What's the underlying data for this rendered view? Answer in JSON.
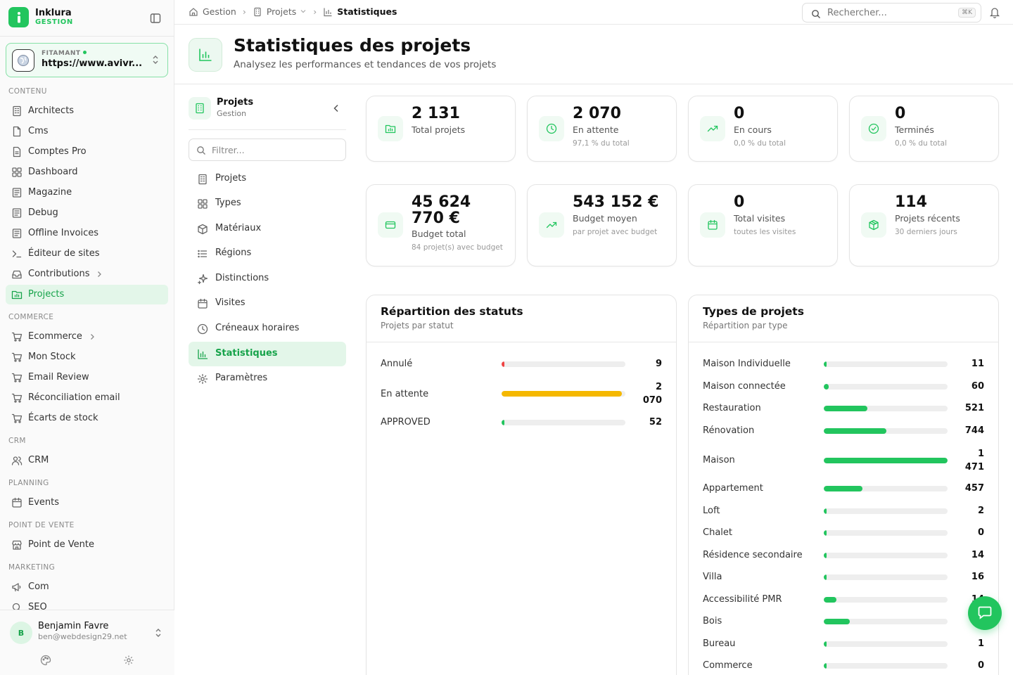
{
  "brand": {
    "name": "Inklura",
    "sub": "GESTION"
  },
  "site": {
    "label": "FITAMANT",
    "url": "https://www.avivr..."
  },
  "sidebar": {
    "sections": [
      {
        "title": "CONTENU",
        "items": [
          {
            "label": "Architects",
            "icon": "building-icon"
          },
          {
            "label": "Cms",
            "icon": "file-icon"
          },
          {
            "label": "Comptes Pro",
            "icon": "file-text-icon"
          },
          {
            "label": "Dashboard",
            "icon": "grid-icon"
          },
          {
            "label": "Magazine",
            "icon": "newspaper-icon"
          },
          {
            "label": "Debug",
            "icon": "newspaper-icon"
          },
          {
            "label": "Offline Invoices",
            "icon": "newspaper-icon"
          },
          {
            "label": "Éditeur de sites",
            "icon": "terminal-icon"
          },
          {
            "label": "Contributions",
            "icon": "inbox-icon",
            "has_children": true
          },
          {
            "label": "Projects",
            "icon": "folder-chart-icon",
            "active": true
          }
        ]
      },
      {
        "title": "COMMERCE",
        "items": [
          {
            "label": "Ecommerce",
            "icon": "cart-icon",
            "has_children": true
          },
          {
            "label": "Mon Stock",
            "icon": "cart-icon"
          },
          {
            "label": "Email Review",
            "icon": "cart-icon"
          },
          {
            "label": "Réconciliation email",
            "icon": "cart-icon"
          },
          {
            "label": "Écarts de stock",
            "icon": "cart-icon"
          }
        ]
      },
      {
        "title": "CRM",
        "items": [
          {
            "label": "CRM",
            "icon": "users-icon"
          }
        ]
      },
      {
        "title": "PLANNING",
        "items": [
          {
            "label": "Events",
            "icon": "calendar-icon"
          }
        ]
      },
      {
        "title": "POINT DE VENTE",
        "items": [
          {
            "label": "Point de Vente",
            "icon": "store-icon"
          }
        ]
      },
      {
        "title": "MARKETING",
        "items": [
          {
            "label": "Com",
            "icon": "megaphone-icon"
          },
          {
            "label": "SEO",
            "icon": "search-icon"
          }
        ]
      }
    ]
  },
  "user": {
    "initial": "B",
    "name": "Benjamin Favre",
    "email": "ben@webdesign29.net"
  },
  "breadcrumb": {
    "home": "Gestion",
    "section": "Projets",
    "current": "Statistiques"
  },
  "search": {
    "placeholder": "Rechercher...",
    "shortcut": "⌘K"
  },
  "page": {
    "title": "Statistiques des projets",
    "subtitle": "Analysez les performances et tendances de vos projets"
  },
  "inner_nav": {
    "title": "Projets",
    "subtitle": "Gestion",
    "filter_placeholder": "Filtrer...",
    "items": [
      {
        "label": "Projets",
        "icon": "building-icon"
      },
      {
        "label": "Types",
        "icon": "grid-icon"
      },
      {
        "label": "Matériaux",
        "icon": "box-icon"
      },
      {
        "label": "Régions",
        "icon": "list-icon"
      },
      {
        "label": "Distinctions",
        "icon": "sparkle-icon"
      },
      {
        "label": "Visites",
        "icon": "calendar-icon"
      },
      {
        "label": "Créneaux horaires",
        "icon": "clock-icon"
      },
      {
        "label": "Statistiques",
        "icon": "bar-chart-icon",
        "active": true
      },
      {
        "label": "Paramètres",
        "icon": "gear-icon"
      }
    ]
  },
  "stats": [
    {
      "value": "2 131",
      "label": "Total projets",
      "sub": "",
      "icon": "folder-chart-icon"
    },
    {
      "value": "2 070",
      "label": "En attente",
      "sub": "97,1 % du total",
      "icon": "clock-icon"
    },
    {
      "value": "0",
      "label": "En cours",
      "sub": "0,0 % du total",
      "icon": "trending-up-icon"
    },
    {
      "value": "0",
      "label": "Terminés",
      "sub": "0,0 % du total",
      "icon": "check-circle-icon"
    },
    {
      "value_line1": "45 624",
      "value_line2": "770 €",
      "label": "Budget total",
      "sub": "84 projet(s) avec budget",
      "icon": "credit-card-icon"
    },
    {
      "value": "543 152 €",
      "label": "Budget moyen",
      "sub": "par projet avec budget",
      "icon": "trending-up-icon"
    },
    {
      "value": "0",
      "label": "Total visites",
      "sub": "toutes les visites",
      "icon": "calendar-icon"
    },
    {
      "value": "114",
      "label": "Projets récents",
      "sub": "30 derniers jours",
      "icon": "package-icon"
    }
  ],
  "status_panel": {
    "title": "Répartition des statuts",
    "subtitle": "Projets par statut",
    "rows": [
      {
        "label": "Annulé",
        "value_line1": "9",
        "value_line2": "",
        "fraction": 0.004,
        "color": "#ef4444"
      },
      {
        "label": "En attente",
        "value_line1": "2",
        "value_line2": "070",
        "fraction": 0.971,
        "color": "#f5b800"
      },
      {
        "label": "APPROVED",
        "value_line1": "52",
        "value_line2": "",
        "fraction": 0.024,
        "color": "#22c55e"
      }
    ]
  },
  "types_panel": {
    "title": "Types de projets",
    "subtitle": "Répartition par type",
    "rows": [
      {
        "label": "Maison Individuelle",
        "value_line1": "11",
        "value_line2": "",
        "fraction": 0.007
      },
      {
        "label": "Maison connectée",
        "value_line1": "60",
        "value_line2": "",
        "fraction": 0.041
      },
      {
        "label": "Restauration",
        "value_line1": "521",
        "value_line2": "",
        "fraction": 0.354
      },
      {
        "label": "Rénovation",
        "value_line1": "744",
        "value_line2": "",
        "fraction": 0.506
      },
      {
        "label": "Maison",
        "value_line1": "1",
        "value_line2": "471",
        "fraction": 1.0
      },
      {
        "label": "Appartement",
        "value_line1": "457",
        "value_line2": "",
        "fraction": 0.311
      },
      {
        "label": "Loft",
        "value_line1": "2",
        "value_line2": "",
        "fraction": 0.001
      },
      {
        "label": "Chalet",
        "value_line1": "0",
        "value_line2": "",
        "fraction": 0.0
      },
      {
        "label": "Résidence secondaire",
        "value_line1": "14",
        "value_line2": "",
        "fraction": 0.01
      },
      {
        "label": "Villa",
        "value_line1": "16",
        "value_line2": "",
        "fraction": 0.011
      },
      {
        "label": "Accessibilité PMR",
        "value_line1": "14",
        "value_line2": "",
        "fraction": 0.1
      },
      {
        "label": "Bois",
        "value_line1": "3",
        "value_line2": "",
        "fraction": 0.21
      },
      {
        "label": "Bureau",
        "value_line1": "1",
        "value_line2": "",
        "fraction": 0.001
      },
      {
        "label": "Commerce",
        "value_line1": "0",
        "value_line2": "",
        "fraction": 0.0
      }
    ],
    "color": "#22c55e"
  },
  "fab": {
    "icon": "chat-icon"
  }
}
